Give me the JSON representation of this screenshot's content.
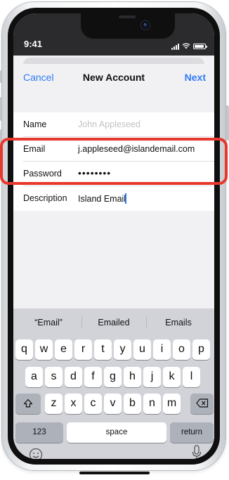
{
  "status_bar": {
    "time": "9:41",
    "battery_level": 0.9
  },
  "nav": {
    "cancel": "Cancel",
    "title": "New Account",
    "next": "Next"
  },
  "form": {
    "name_label": "Name",
    "name_placeholder": "John Appleseed",
    "email_label": "Email",
    "email_value": "j.appleseed@islandemail.com",
    "password_label": "Password",
    "password_value": "••••••••",
    "description_label": "Description",
    "description_value": "Island Email"
  },
  "keyboard": {
    "suggestions": [
      "“Email”",
      "Emailed",
      "Emails"
    ],
    "row1": [
      "q",
      "w",
      "e",
      "r",
      "t",
      "y",
      "u",
      "i",
      "o",
      "p"
    ],
    "row2": [
      "a",
      "s",
      "d",
      "f",
      "g",
      "h",
      "j",
      "k",
      "l"
    ],
    "row3": [
      "z",
      "x",
      "c",
      "v",
      "b",
      "n",
      "m"
    ],
    "numbers_key": "123",
    "space_key": "space",
    "return_key": "return"
  },
  "colors": {
    "accent": "#2f7cf6",
    "highlight": "#e8372c"
  },
  "icons": {
    "shift": "shift-icon",
    "delete": "delete-icon",
    "emoji": "emoji-icon",
    "mic": "mic-icon"
  }
}
